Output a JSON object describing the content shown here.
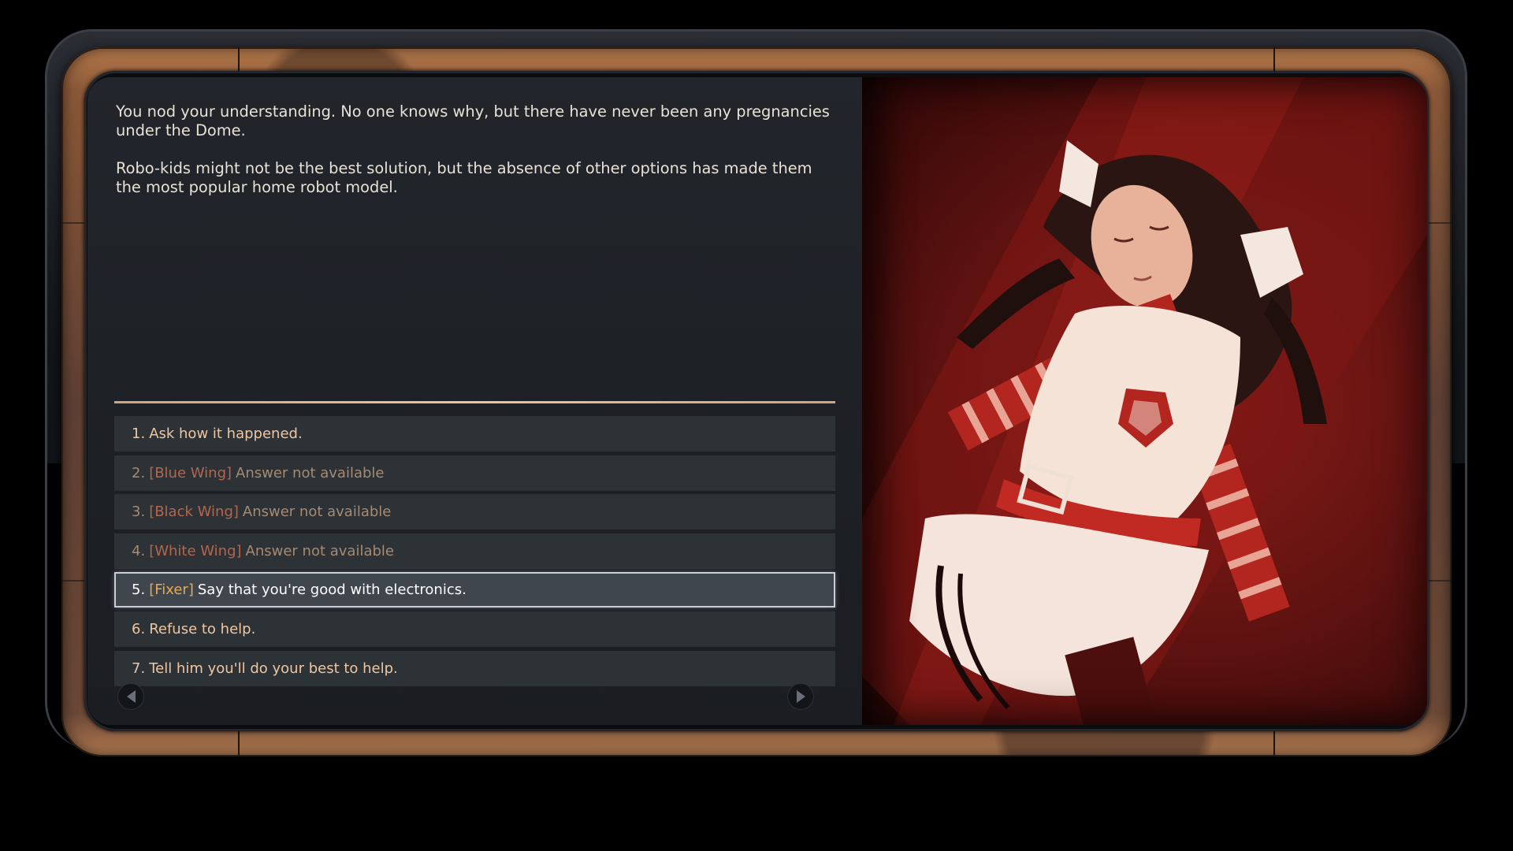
{
  "dialogue": {
    "paragraphs": [
      "You nod your understanding. No one knows why, but there have never been any pregnancies under the Dome.",
      "Robo-kids might not be the best solution, but the absence of other options has made them the most popular home robot model."
    ]
  },
  "choices": [
    {
      "num": "1.",
      "tag": "",
      "text": "Ask how it happened.",
      "state": "enabled"
    },
    {
      "num": "2.",
      "tag": "[Blue Wing]",
      "text": "Answer not available",
      "state": "disabled"
    },
    {
      "num": "3.",
      "tag": "[Black Wing]",
      "text": "Answer not available",
      "state": "disabled"
    },
    {
      "num": "4.",
      "tag": "[White Wing]",
      "text": "Answer not available",
      "state": "disabled"
    },
    {
      "num": "5.",
      "tag": "[Fixer]",
      "text": "Say that you're good with electronics.",
      "state": "selected"
    },
    {
      "num": "6.",
      "tag": "",
      "text": "Refuse to help.",
      "state": "enabled"
    },
    {
      "num": "7.",
      "tag": "",
      "text": "Tell him you'll do your best to help.",
      "state": "enabled"
    }
  ],
  "icons": {
    "scroll_left": "triangle-left-icon",
    "scroll_right": "triangle-right-icon"
  },
  "colors": {
    "choice_text": "#eec6a2",
    "disabled_tag": "#b3664e",
    "fixer_tag": "#e6a852",
    "divider": "#f0c39a"
  }
}
